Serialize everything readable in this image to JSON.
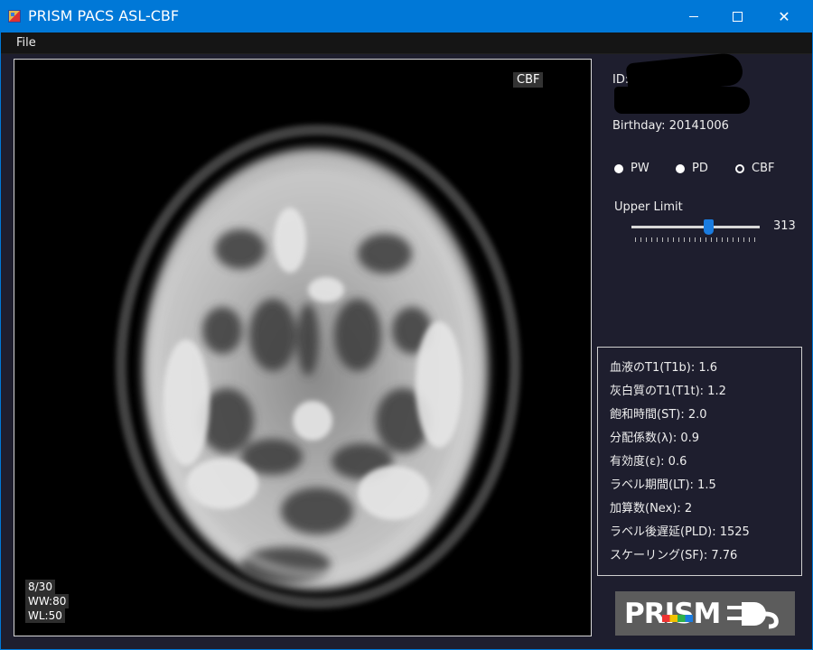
{
  "window": {
    "title": "PRISM PACS ASL-CBF"
  },
  "menu": {
    "file": "File"
  },
  "viewer": {
    "mode_tag": "CBF",
    "slice": "8/30",
    "ww": "WW:80",
    "wl": "WL:50"
  },
  "patient": {
    "id_label": "ID: 1",
    "birthday": "Birthday: 20141006"
  },
  "radios": {
    "options": [
      "PW",
      "PD",
      "CBF"
    ],
    "selected": "CBF"
  },
  "upper_limit": {
    "label": "Upper Limit",
    "value": "313",
    "position_fraction": 0.6
  },
  "params": [
    "血液のT1(T1b): 1.6",
    "灰白質のT1(T1t): 1.2",
    "飽和時間(ST): 2.0",
    "分配係数(λ): 0.9",
    "有効度(ε): 0.6",
    "ラベル期間(LT): 1.5",
    "加算数(Nex): 2",
    "ラベル後遅延(PLD): 1525",
    "スケーリング(SF): 7.76"
  ],
  "logo": {
    "text": "PRISM"
  },
  "colors": {
    "titlebar": "#0078d7",
    "background": "#1e1e2e",
    "accent": "#1a7ce0"
  }
}
